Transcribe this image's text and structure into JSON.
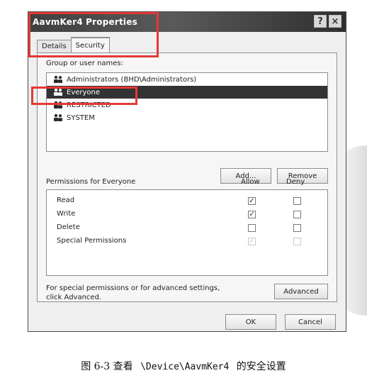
{
  "window": {
    "title": "AavmKer4 Properties",
    "controls": {
      "help": "?",
      "close": "×"
    }
  },
  "tabs": [
    {
      "label": "Details"
    },
    {
      "label": "Security"
    }
  ],
  "security": {
    "group_label": "Group or user names:",
    "users": [
      {
        "name": "Administrators (BHD\\Administrators)",
        "selected": false
      },
      {
        "name": "Everyone",
        "selected": true
      },
      {
        "name": "RESTRICTED",
        "selected": false
      },
      {
        "name": "SYSTEM",
        "selected": false
      }
    ],
    "add_button": "Add...",
    "remove_button": "Remove",
    "permissions_label": "Permissions for Everyone",
    "allow_header": "Allow",
    "deny_header": "Deny",
    "permissions": [
      {
        "name": "Read",
        "allow": true,
        "deny": false,
        "allow_disabled": false,
        "deny_disabled": false
      },
      {
        "name": "Write",
        "allow": true,
        "deny": false,
        "allow_disabled": false,
        "deny_disabled": false
      },
      {
        "name": "Delete",
        "allow": false,
        "deny": false,
        "allow_disabled": false,
        "deny_disabled": false
      },
      {
        "name": "Special Permissions",
        "allow": true,
        "deny": false,
        "allow_disabled": true,
        "deny_disabled": true
      }
    ],
    "advanced_note_line1": "For special permissions or for advanced settings,",
    "advanced_note_line2": "click Advanced.",
    "advanced_button": "Advanced"
  },
  "footer": {
    "ok": "OK",
    "cancel": "Cancel"
  },
  "caption": {
    "prefix": "图 6-3  查看",
    "path": "\\Device\\AavmKer4",
    "suffix": "的安全设置"
  },
  "colors": {
    "annotation_red": "#e53935",
    "selected_row": "#333333"
  },
  "icons": {
    "user_icon": "users-icon",
    "help_icon": "help-icon",
    "close_icon": "close-icon"
  }
}
